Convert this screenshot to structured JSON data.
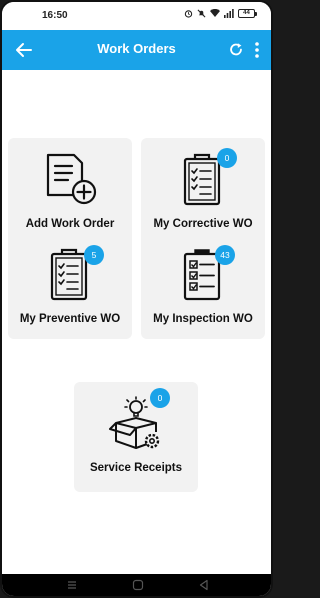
{
  "status_bar": {
    "time": "16:50",
    "battery": "44"
  },
  "app_bar": {
    "title": "Work Orders"
  },
  "cards": [
    {
      "label": "Add Work Order",
      "icon": "add-document-icon",
      "badge": ""
    },
    {
      "label": "My Corrective WO",
      "icon": "clipboard-list-icon",
      "badge": "0"
    },
    {
      "label": "My Preventive WO",
      "icon": "clipboard-list-icon",
      "badge": "5"
    },
    {
      "label": "My Inspection WO",
      "icon": "clipboard-checklist-icon",
      "badge": "43"
    },
    {
      "label": "Service Receipts",
      "icon": "service-box-icon",
      "badge": "0"
    }
  ],
  "colors": {
    "primary": "#1aa3e8",
    "card_bg": "#f2f2f2",
    "text": "#111111"
  }
}
